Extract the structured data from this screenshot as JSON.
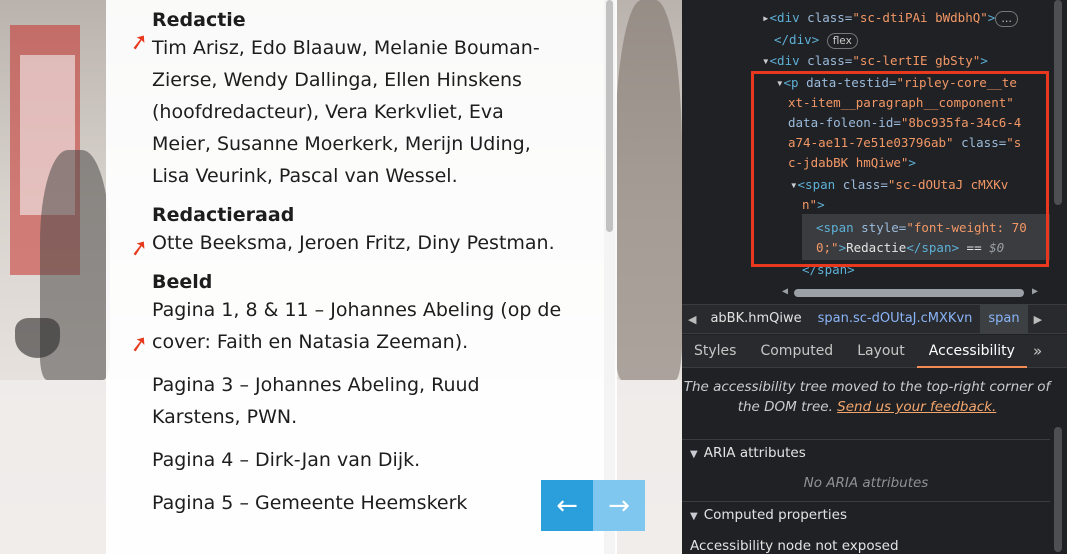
{
  "article": {
    "sections": [
      {
        "title": "Redactie",
        "paragraphs": [
          "Tim Arisz, Edo Blaauw, Melanie Bouman-Zierse, Wendy Dallinga, Ellen Hinskens (hoofdredacteur), Vera Kerkvliet, Eva Meier, Susanne Moerkerk, Merijn Uding, Lisa Veurink, Pascal van Wessel."
        ]
      },
      {
        "title": "Redactieraad",
        "paragraphs": [
          "Otte Beeksma, Jeroen Fritz, Diny Pestman."
        ]
      },
      {
        "title": "Beeld",
        "paragraphs": [
          "Pagina 1, 8 & 11 – Johannes Abeling (op de cover: Faith en Natasia Zeeman).",
          "Pagina 3 – Johannes Abeling, Ruud Karstens, PWN.",
          "Pagina 4 – Dirk-Jan van Dijk.",
          "Pagina 5 – Gemeente Heemskerk"
        ]
      }
    ],
    "nav": {
      "prev_icon": "arrow-left-icon",
      "next_icon": "arrow-right-icon"
    },
    "annotation_color": "#e8391f"
  },
  "devtools": {
    "dom": {
      "line1_tag": "<div",
      "line1_attr": " class=",
      "line1_val": "\"sc-dtiPAi bWdbhQ\"",
      "line1_end": ">",
      "line1_ellipsis": "…",
      "line2_close": "</div>",
      "line2_pill": "flex",
      "line3_tag": "<div",
      "line3_attr": " class=",
      "line3_val": "\"sc-lertIE gbSty\"",
      "line3_end": ">",
      "p_open": "<p",
      "p_attr1": " data-testid=",
      "p_val1a": "\"ripley-core__te",
      "p_val1b": "xt-item__paragraph__component\"",
      "p_attr2": "data-foleon-id=",
      "p_val2a": "\"8bc935fa-34c6-4",
      "p_val2b": "a74-ae11-7e51e03796ab\"",
      "p_attr3": " class=",
      "p_val3a": "\"s",
      "p_val3b": "c-jdabBK hmQiwe\"",
      "p_end": ">",
      "span_open": "<span",
      "span_attr": " class=",
      "span_val_a": "\"sc-dOUtaJ cMXKv",
      "span_val_b": "n\"",
      "span_end": ">",
      "inner_open": "<span",
      "inner_attr": " style=",
      "inner_val_a": "\"font-weight: 70",
      "inner_val_b": "0;\"",
      "inner_end": ">",
      "inner_text": "Redactie",
      "inner_close": "</span>",
      "inner_eq": " == ",
      "inner_dollar": "$0",
      "span_close": "</span>"
    },
    "breadcrumbs": [
      "abBK.hmQiwe",
      "span.sc-dOUtaJ.cMXKvn",
      "span"
    ],
    "tabs": [
      "Styles",
      "Computed",
      "Layout",
      "Accessibility"
    ],
    "active_tab": "Accessibility",
    "more_tabs_label": "»",
    "accessibility": {
      "notice_line1": "The accessibility tree moved to the top-right corner of",
      "notice_line2_prefix": "the DOM tree.",
      "feedback_link": "Send us your feedback.",
      "aria_header": "ARIA attributes",
      "aria_empty": "No ARIA attributes",
      "computed_header": "Computed properties",
      "node_status": "Accessibility node not exposed"
    },
    "highlight_color": "#e8391f"
  }
}
